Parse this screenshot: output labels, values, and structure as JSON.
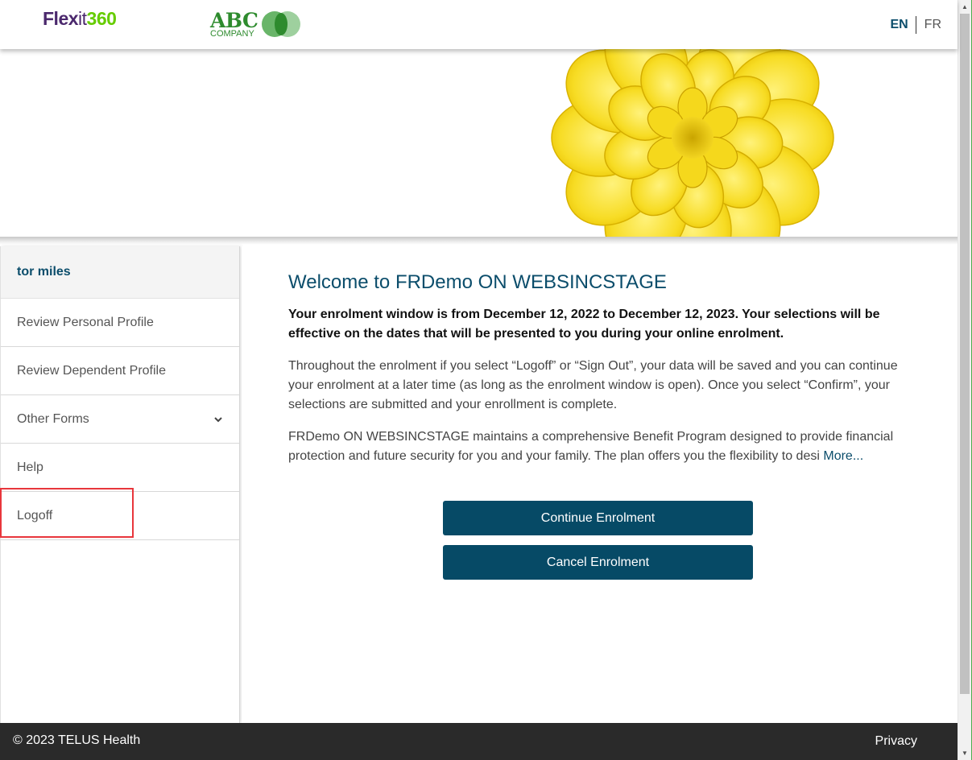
{
  "header": {
    "logo_part1": "Flex",
    "logo_part2": "it",
    "logo_part3": "360",
    "company_logo_main": "ABC",
    "company_logo_sub": "COMPANY",
    "lang_en": "EN",
    "lang_fr": "FR"
  },
  "sidebar": {
    "user_name": "tor miles",
    "items": [
      {
        "label": "Review Personal Profile"
      },
      {
        "label": "Review Dependent Profile"
      },
      {
        "label": "Other Forms"
      },
      {
        "label": "Help"
      },
      {
        "label": "Logoff"
      }
    ]
  },
  "main": {
    "title": "Welcome to FRDemo ON WEBSINCSTAGE",
    "bold_paragraph": "Your enrolment window is from December 12, 2022 to December 12, 2023. Your selections will be effective on the dates that will be presented to you during your online enrolment.",
    "paragraph1": "Throughout the enrolment if you select “Logoff” or “Sign Out”, your data will be saved and you can continue your enrolment at a later time (as long as the enrolment window is open). Once you select “Confirm”, your selections are submitted and your enrollment is complete.",
    "paragraph2": "FRDemo ON WEBSINCSTAGE maintains a comprehensive Benefit Program designed to provide financial protection and future security for you and your family.  The plan offers you the flexibility to desi",
    "more_link": "More...",
    "continue_button": "Continue Enrolment",
    "cancel_button": "Cancel Enrolment"
  },
  "footer": {
    "copyright": "© 2023 TELUS Health",
    "privacy": "Privacy"
  },
  "colors": {
    "accent": "#0b4d6b",
    "button": "#064a66",
    "highlight": "#e8363c",
    "footer_bg": "#2a2a2a"
  },
  "icons": {
    "chevron": "chevron-down-icon",
    "flower": "flower-banner-image"
  }
}
